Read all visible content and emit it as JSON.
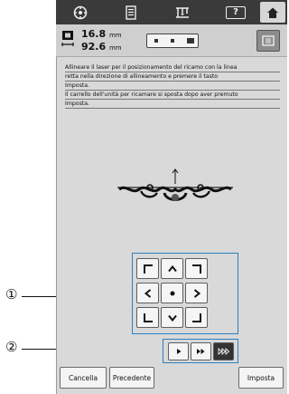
{
  "toolbar": {
    "items": [
      {
        "name": "settings",
        "icon": "gear-icon"
      },
      {
        "name": "guide",
        "icon": "document-icon"
      },
      {
        "name": "machine",
        "icon": "sewing-machine-icon"
      },
      {
        "name": "help",
        "label": "?"
      },
      {
        "name": "home",
        "icon": "home-icon"
      }
    ]
  },
  "size": {
    "width": "16.8",
    "height": "92.6",
    "unit": "mm"
  },
  "message": {
    "lines": [
      "Allineare il laser per il posizionamento del ricamo con la linea",
      "retta nella direzione di allineamento e premere il tasto",
      "Imposta.",
      "Il carrello dell'unità per ricamare si sposta dopo aver premuto",
      "Imposta."
    ]
  },
  "callouts": {
    "one": "①",
    "two": "②"
  },
  "buttons": {
    "cancel": "Cancella",
    "previous": "Precedente",
    "set": "Imposta"
  },
  "colors": {
    "accent": "#2c7fc0",
    "marker": "#555555"
  }
}
